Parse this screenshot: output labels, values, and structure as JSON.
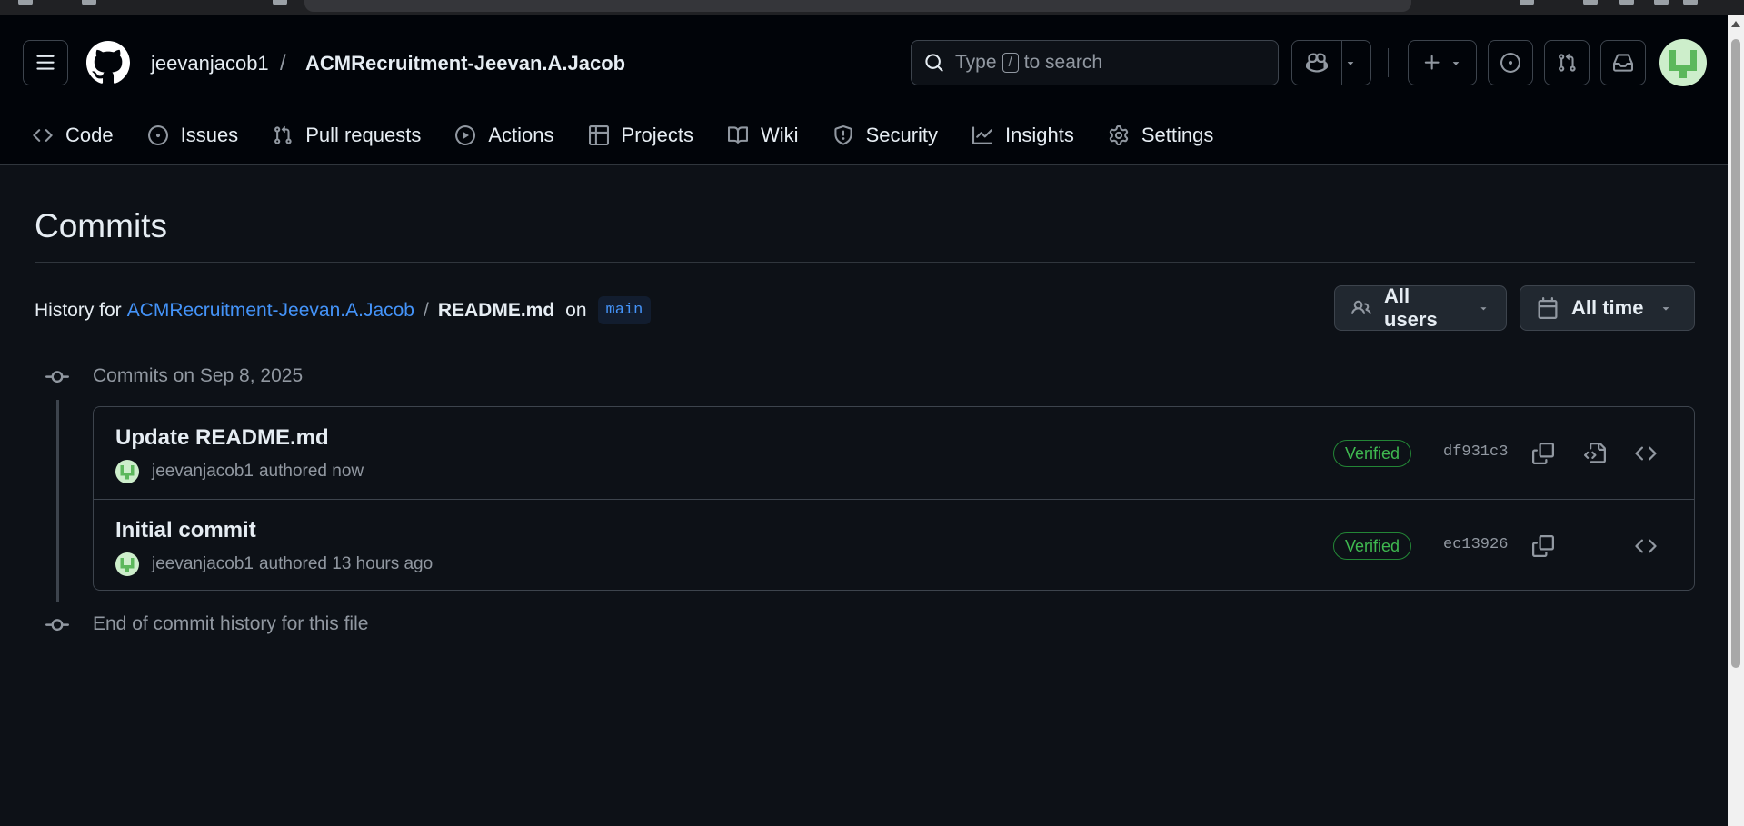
{
  "header": {
    "owner": "jeevanjacob1",
    "separator": "/",
    "repo": "ACMRecruitment-Jeevan.A.Jacob",
    "search_prefix": "Type",
    "search_key": "/",
    "search_suffix": "to search"
  },
  "tabs": [
    {
      "label": "Code",
      "icon": "code-icon"
    },
    {
      "label": "Issues",
      "icon": "issue-icon"
    },
    {
      "label": "Pull requests",
      "icon": "pull-request-icon"
    },
    {
      "label": "Actions",
      "icon": "play-icon"
    },
    {
      "label": "Projects",
      "icon": "table-icon"
    },
    {
      "label": "Wiki",
      "icon": "book-icon"
    },
    {
      "label": "Security",
      "icon": "shield-icon"
    },
    {
      "label": "Insights",
      "icon": "graph-icon"
    },
    {
      "label": "Settings",
      "icon": "gear-icon"
    }
  ],
  "page": {
    "title": "Commits",
    "history_prefix": "History for",
    "history_repo": "ACMRecruitment-Jeevan.A.Jacob",
    "history_sep": "/",
    "history_file": "README.md",
    "history_on": "on",
    "branch": "main",
    "users_filter": "All users",
    "time_filter": "All time"
  },
  "timeline": {
    "group_label": "Commits on Sep 8, 2025",
    "end_label": "End of commit history for this file"
  },
  "commits": [
    {
      "title": "Update README.md",
      "author": "jeevanjacob1",
      "authored": "authored now",
      "badge": "Verified",
      "sha": "df931c3"
    },
    {
      "title": "Initial commit",
      "author": "jeevanjacob1",
      "authored": "authored 13 hours ago",
      "badge": "Verified",
      "sha": "ec13926"
    }
  ],
  "colors": {
    "background": "#0d1117",
    "header": "#010409",
    "link": "#4493f8",
    "verified": "#3fb950",
    "border": "#3d444d"
  }
}
